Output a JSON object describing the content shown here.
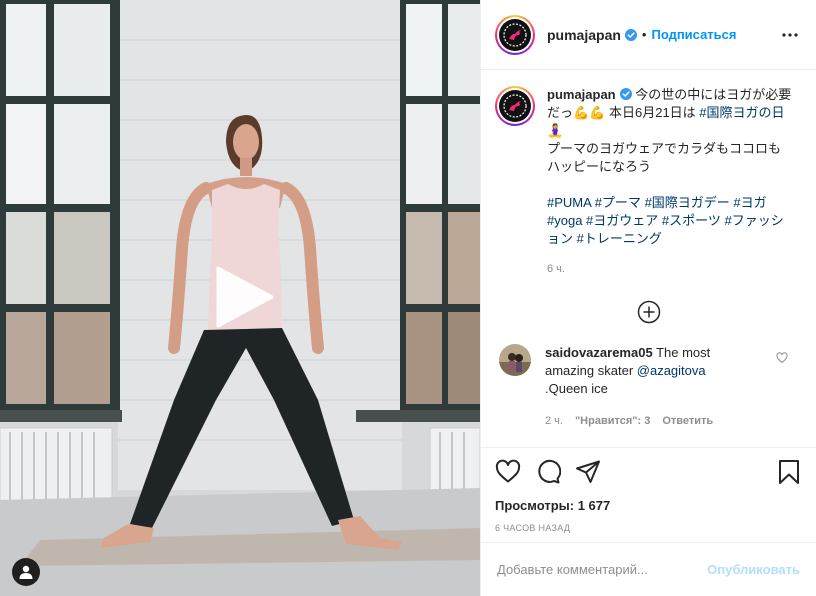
{
  "post": {
    "username": "pumajapan",
    "follow_label": "Подписаться",
    "dot": "•",
    "caption": {
      "username": "pumajapan",
      "text_pre": "今の世の中にはヨガが必要だっ💪💪 本日6月21日は ",
      "hashtag_day": "#国際ヨガの日",
      "line_emoji": "🧘‍♀️",
      "line2": "プーマのヨガウェアでカラダもココロもハッピーになろう",
      "hashtags": [
        "#PUMA",
        "#プーマ",
        "#国際ヨガデー",
        "#ヨガ",
        "#yoga",
        "#ヨガウェア",
        "#スポーツ",
        "#ファッション",
        "#トレーニング"
      ],
      "time": "6 ч."
    },
    "comment": {
      "username": "saidovazarema05",
      "text_a": " The most amazing skater ",
      "mention": "@azagitova",
      "text_b": " .Queen ice",
      "time": "2 ч.",
      "likes_label": "\"Нравится\": 3",
      "reply_label": "Ответить"
    },
    "views_label": "Просмотры:",
    "views_count": "1 677",
    "ago": "6 часов назад",
    "comment_placeholder": "Добавьте комментарий...",
    "publish_label": "Опубликовать"
  },
  "icons": {
    "verified": "verified-badge-icon",
    "more": "more-options-icon",
    "play": "play-icon",
    "user_tag": "user-tag-icon",
    "plus": "load-more-comments-icon",
    "like": "heart-icon",
    "comment": "comment-icon",
    "share": "share-icon",
    "save": "bookmark-icon"
  },
  "colors": {
    "accent": "#0095f6",
    "publish_disabled": "#b2dffc",
    "hashtag": "#00376b",
    "muted": "#8e8e8e"
  }
}
